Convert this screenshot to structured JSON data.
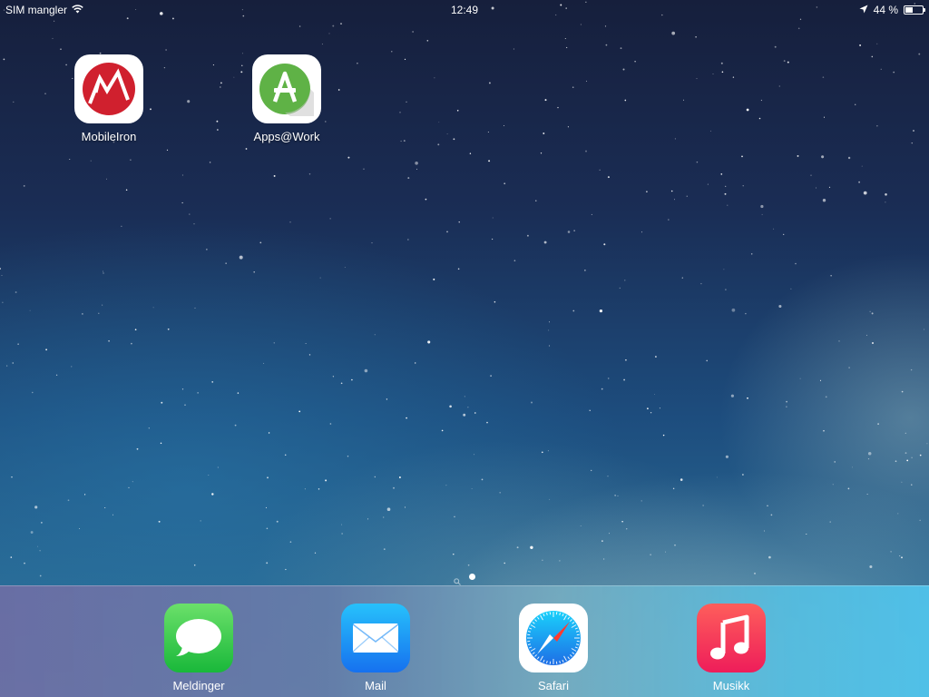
{
  "status_bar": {
    "carrier": "SIM mangler",
    "time": "12:49",
    "battery_percent_text": "44 %",
    "battery_level": 0.44
  },
  "home_screen": {
    "apps": [
      {
        "label": "MobileIron",
        "icon": "mobileiron-icon"
      },
      {
        "label": "Apps@Work",
        "icon": "apps-at-work-icon"
      }
    ],
    "page_count": 1,
    "active_page": 1
  },
  "dock": {
    "apps": [
      {
        "label": "Meldinger",
        "icon": "messages-icon"
      },
      {
        "label": "Mail",
        "icon": "mail-icon"
      },
      {
        "label": "Safari",
        "icon": "safari-icon"
      },
      {
        "label": "Musikk",
        "icon": "music-icon"
      }
    ]
  },
  "colors": {
    "mobileiron_red": "#d0202e",
    "apps_at_work_green": "#5fb246",
    "messages_green": "#34c94a",
    "mail_blue": "#1a8cf5",
    "safari_blue": "#1e7fe6",
    "music_red": "#f2395a"
  }
}
